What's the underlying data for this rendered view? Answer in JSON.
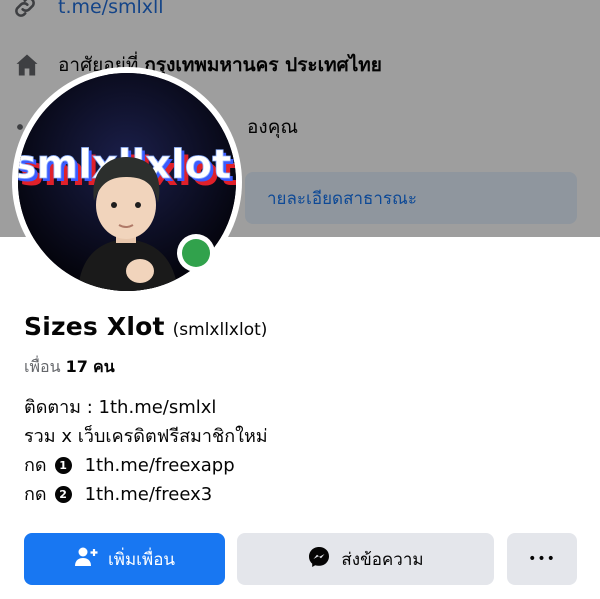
{
  "background": {
    "link_text": "t.me/smlxll",
    "address_prefix": "อาศัยอยู่ที่",
    "address_city": "กรุงเทพมหานคร ประเทศไทย",
    "partial_row_text": "องคุณ",
    "edit_details_label": "ายละเอียดสาธารณะ"
  },
  "avatar": {
    "image_text": "smlxllxlot",
    "online_status_color": "#31a24c"
  },
  "profile": {
    "name": "Sizes Xlot",
    "username": "(smlxllxlot)",
    "friends_prefix": "เพื่อน",
    "friends_count": "17",
    "friends_suffix": "คน"
  },
  "bio": {
    "line1": "ติดตาม :  1th.me/smlxl",
    "line2": "รวม x เว็บเครดิตฟรีสมาชิกใหม่",
    "line3_prefix": "กด",
    "line3_badge": "1",
    "line3_link": "1th.me/freexapp",
    "line4_prefix": "กด",
    "line4_badge": "2",
    "line4_link": "1th.me/freex3"
  },
  "buttons": {
    "add_friend_label": "เพิ่มเพื่อน",
    "message_label": "ส่งข้อความ",
    "more_label": "•••"
  },
  "colors": {
    "primary": "#1877f2",
    "secondary_button": "#e4e6eb",
    "online": "#31a24c"
  }
}
